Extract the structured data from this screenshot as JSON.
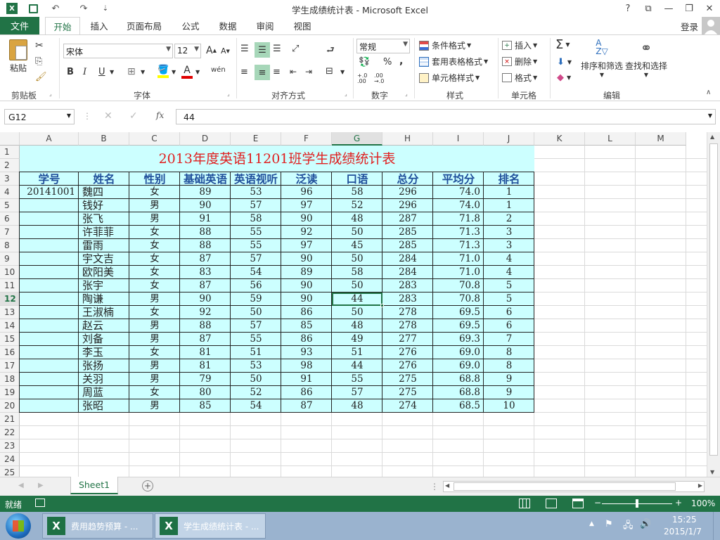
{
  "window": {
    "title": "学生成绩统计表 - Microsoft Excel",
    "help": "?",
    "restore_ribbon": "⧉",
    "minimize": "—",
    "maximize": "❐",
    "close": "✕"
  },
  "qat": {
    "save": "💾",
    "undo": "↶",
    "redo": "↷",
    "more": "⇣"
  },
  "tabs": {
    "file": "文件",
    "items": [
      "开始",
      "插入",
      "页面布局",
      "公式",
      "数据",
      "审阅",
      "视图"
    ],
    "login": "登录"
  },
  "ribbon": {
    "clipboard": {
      "paste": "粘贴",
      "label": "剪贴板"
    },
    "font": {
      "name": "宋体",
      "size": "12",
      "bold": "B",
      "italic": "I",
      "underline": "U",
      "wen": "wén",
      "label": "字体"
    },
    "alignment": {
      "label": "对齐方式"
    },
    "number": {
      "format": "常规",
      "label": "数字",
      "percent": "%",
      "comma": ",",
      "inc": "+.0 .00",
      "dec": ".00 →.0"
    },
    "styles": {
      "conditional": "条件格式",
      "table": "套用表格格式",
      "cell": "单元格样式",
      "label": "样式"
    },
    "cells": {
      "insert": "插入",
      "delete": "删除",
      "format": "格式",
      "label": "单元格"
    },
    "editing": {
      "sort": "排序和筛选",
      "find": "查找和选择",
      "label": "编辑"
    }
  },
  "formula_bar": {
    "name_box": "G12",
    "fx": "fx",
    "value": "44"
  },
  "columns": [
    "A",
    "B",
    "C",
    "D",
    "E",
    "F",
    "G",
    "H",
    "I",
    "J",
    "K",
    "L",
    "M"
  ],
  "selected_column": "G",
  "selected_row": "12",
  "rows": [
    "1",
    "2",
    "3",
    "4",
    "5",
    "6",
    "7",
    "8",
    "9",
    "10",
    "11",
    "12",
    "13",
    "14",
    "15",
    "16",
    "17",
    "18",
    "19",
    "20",
    "21",
    "22",
    "23",
    "24",
    "25"
  ],
  "sheet": {
    "title": "2013年度英语11201班学生成绩统计表",
    "headers": [
      "学号",
      "姓名",
      "性别",
      "基础英语",
      "英语视听",
      "泛读",
      "口语",
      "总分",
      "平均分",
      "排名"
    ],
    "records": [
      [
        "20141001",
        "魏四",
        "女",
        "89",
        "53",
        "96",
        "58",
        "296",
        "74.0",
        "1"
      ],
      [
        "",
        "钱好",
        "男",
        "90",
        "57",
        "97",
        "52",
        "296",
        "74.0",
        "1"
      ],
      [
        "",
        "张飞",
        "男",
        "91",
        "58",
        "90",
        "48",
        "287",
        "71.8",
        "2"
      ],
      [
        "",
        "许菲菲",
        "女",
        "88",
        "55",
        "92",
        "50",
        "285",
        "71.3",
        "3"
      ],
      [
        "",
        "雷雨",
        "女",
        "88",
        "55",
        "97",
        "45",
        "285",
        "71.3",
        "3"
      ],
      [
        "",
        "宇文吉",
        "女",
        "87",
        "57",
        "90",
        "50",
        "284",
        "71.0",
        "4"
      ],
      [
        "",
        "欧阳美",
        "女",
        "83",
        "54",
        "89",
        "58",
        "284",
        "71.0",
        "4"
      ],
      [
        "",
        "张宇",
        "女",
        "87",
        "56",
        "90",
        "50",
        "283",
        "70.8",
        "5"
      ],
      [
        "",
        "陶谦",
        "男",
        "90",
        "59",
        "90",
        "44",
        "283",
        "70.8",
        "5"
      ],
      [
        "",
        "王淑楠",
        "女",
        "92",
        "50",
        "86",
        "50",
        "278",
        "69.5",
        "6"
      ],
      [
        "",
        "赵云",
        "男",
        "88",
        "57",
        "85",
        "48",
        "278",
        "69.5",
        "6"
      ],
      [
        "",
        "刘备",
        "男",
        "87",
        "55",
        "86",
        "49",
        "277",
        "69.3",
        "7"
      ],
      [
        "",
        "李玉",
        "女",
        "81",
        "51",
        "93",
        "51",
        "276",
        "69.0",
        "8"
      ],
      [
        "",
        "张扬",
        "男",
        "81",
        "53",
        "98",
        "44",
        "276",
        "69.0",
        "8"
      ],
      [
        "",
        "关羽",
        "男",
        "79",
        "50",
        "91",
        "55",
        "275",
        "68.8",
        "9"
      ],
      [
        "",
        "周蓝",
        "女",
        "80",
        "52",
        "86",
        "57",
        "275",
        "68.8",
        "9"
      ],
      [
        "",
        "张昭",
        "男",
        "85",
        "54",
        "87",
        "48",
        "274",
        "68.5",
        "10"
      ]
    ]
  },
  "sheet_tabs": {
    "active": "Sheet1",
    "add": "+"
  },
  "status": {
    "ready": "就绪",
    "zoom": "100%",
    "minus": "−",
    "plus": "+"
  },
  "taskbar": {
    "items": [
      "费用趋势预算 - ...",
      "学生成绩统计表 - ..."
    ],
    "time": "15:25",
    "date": "2015/1/7"
  },
  "colors": {
    "accent": "#217346",
    "table_fill": "#ccffff",
    "title_red": "#e02020",
    "header_blue": "#1f4e9a"
  }
}
